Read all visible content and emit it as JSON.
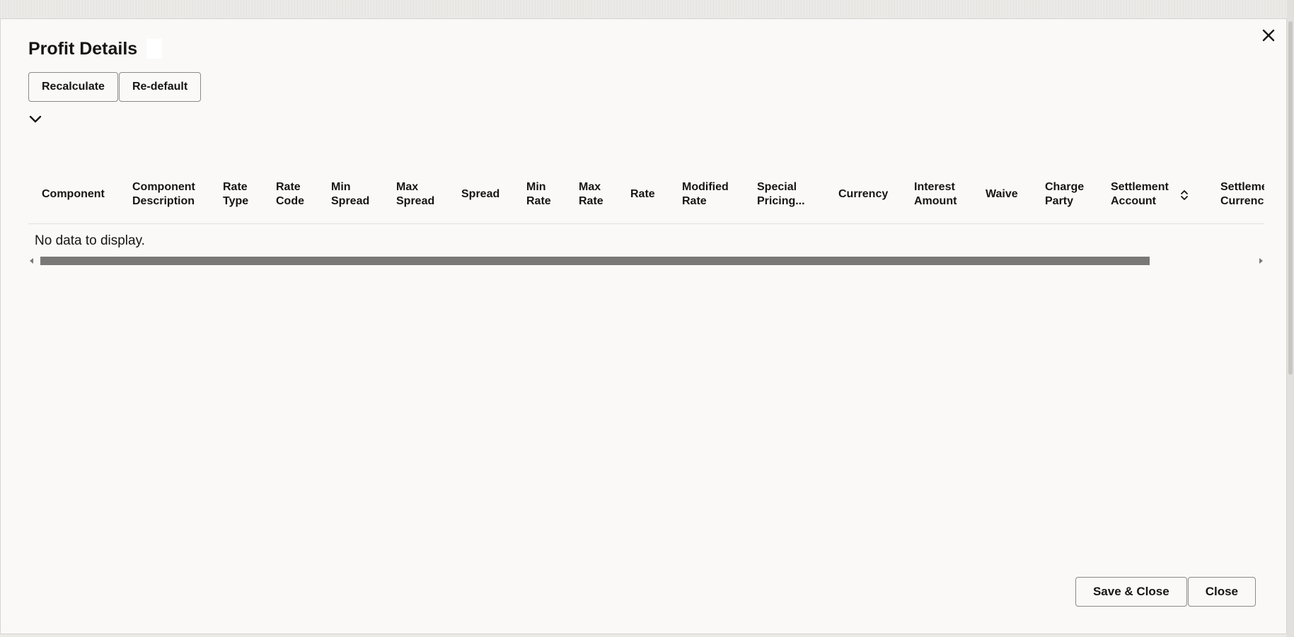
{
  "dialog": {
    "title": "Profit Details",
    "close_icon": "close-icon"
  },
  "toolbar": {
    "recalculate_label": "Recalculate",
    "redefault_label": "Re-default",
    "expand_icon": "chevron-down-icon"
  },
  "table": {
    "columns": [
      {
        "line1": "Component",
        "line2": ""
      },
      {
        "line1": "Component",
        "line2": "Description"
      },
      {
        "line1": "Rate",
        "line2": "Type"
      },
      {
        "line1": "Rate",
        "line2": "Code"
      },
      {
        "line1": "Min",
        "line2": "Spread"
      },
      {
        "line1": "Max",
        "line2": "Spread"
      },
      {
        "line1": "Spread",
        "line2": ""
      },
      {
        "line1": "Min",
        "line2": "Rate"
      },
      {
        "line1": "Max",
        "line2": "Rate"
      },
      {
        "line1": "Rate",
        "line2": ""
      },
      {
        "line1": "Modified",
        "line2": "Rate"
      },
      {
        "line1": "Special",
        "line2": "Pricing..."
      },
      {
        "line1": "Currency",
        "line2": ""
      },
      {
        "line1": "Interest",
        "line2": "Amount"
      },
      {
        "line1": "Waive",
        "line2": ""
      },
      {
        "line1": "Charge",
        "line2": "Party"
      },
      {
        "line1": "Settlement",
        "line2": "Account"
      },
      {
        "line1": "Settlement",
        "line2": "Currency"
      }
    ],
    "empty_message": "No data to display."
  },
  "footer": {
    "save_close_label": "Save & Close",
    "close_label": "Close"
  },
  "colors": {
    "dialog_bg": "#faf9f8",
    "text": "#161513",
    "scroll_thumb": "#7a7876"
  }
}
